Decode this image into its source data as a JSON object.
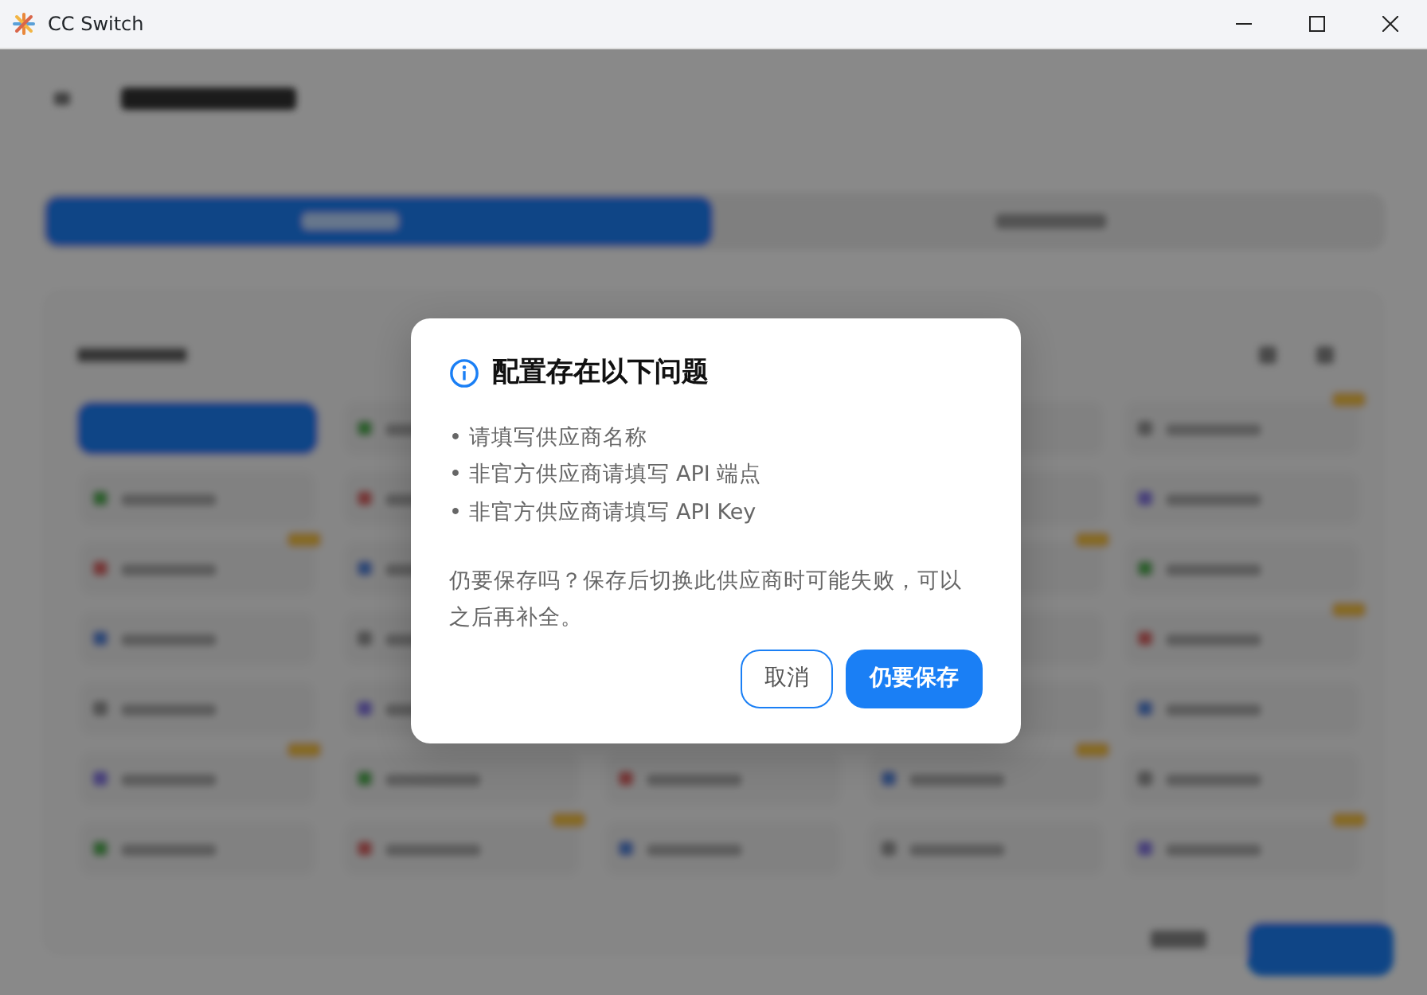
{
  "window": {
    "title": "CC Switch"
  },
  "dialog": {
    "title": "配置存在以下问题",
    "issues": [
      "• 请填写供应商名称",
      "• 非官方供应商请填写 API 端点",
      "• 非官方供应商请填写 API Key"
    ],
    "message": "仍要保存吗？保存后切换此供应商时可能失败，可以之后再补全。",
    "buttons": [
      {
        "label": "取消",
        "kind": "secondary"
      },
      {
        "label": "仍要保存",
        "kind": "primary"
      }
    ]
  }
}
